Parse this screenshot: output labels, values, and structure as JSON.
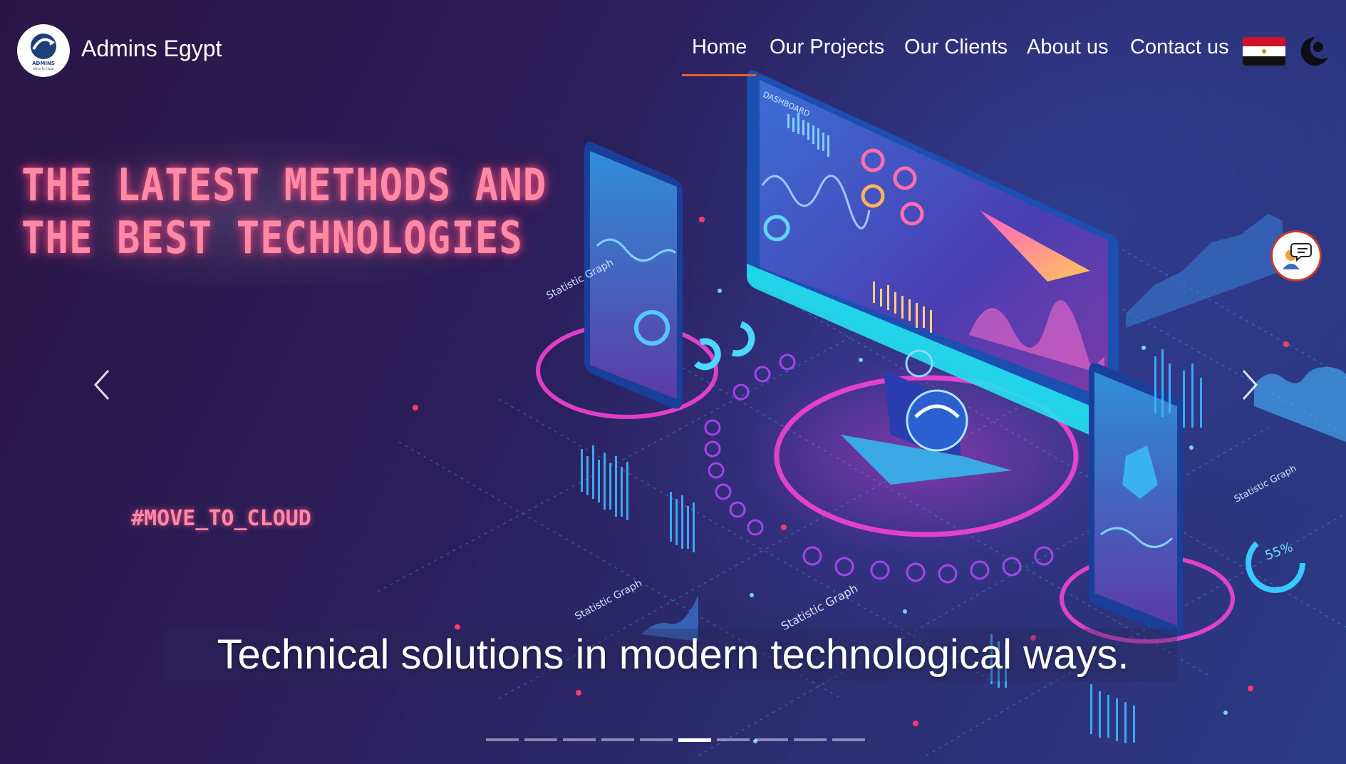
{
  "brand": {
    "name": "Admins Egypt",
    "logo_text": "ADMINS",
    "logo_tagline": "Move To Cloud"
  },
  "nav": {
    "items": [
      {
        "label": "Home",
        "active": true
      },
      {
        "label": "Our Projects"
      },
      {
        "label": "Our Clients"
      },
      {
        "label": "About us"
      },
      {
        "label": "Contact us"
      }
    ],
    "language_flag_icon": "egypt-flag-icon",
    "theme_icon": "dark-mode-icon",
    "accent_color": "#e8612c"
  },
  "hero": {
    "headline_line1": "THE LATEST METHODS AND",
    "headline_line2": "THE BEST TECHNOLOGIES",
    "hashtag": "#MOVE_TO_CLOUD",
    "caption": "Technical solutions in modern technological ways.",
    "prev_icon": "chevron-left-icon",
    "next_icon": "chevron-right-icon",
    "chat_icon": "chat-support-icon",
    "illustration_labels": [
      "DASHBOARD",
      "Statistic Graph",
      "55%",
      "Statistic Graph",
      "Statistic Graph",
      "Statistic Graph"
    ]
  },
  "carousel": {
    "slide_count": 10,
    "active_index": 5
  }
}
